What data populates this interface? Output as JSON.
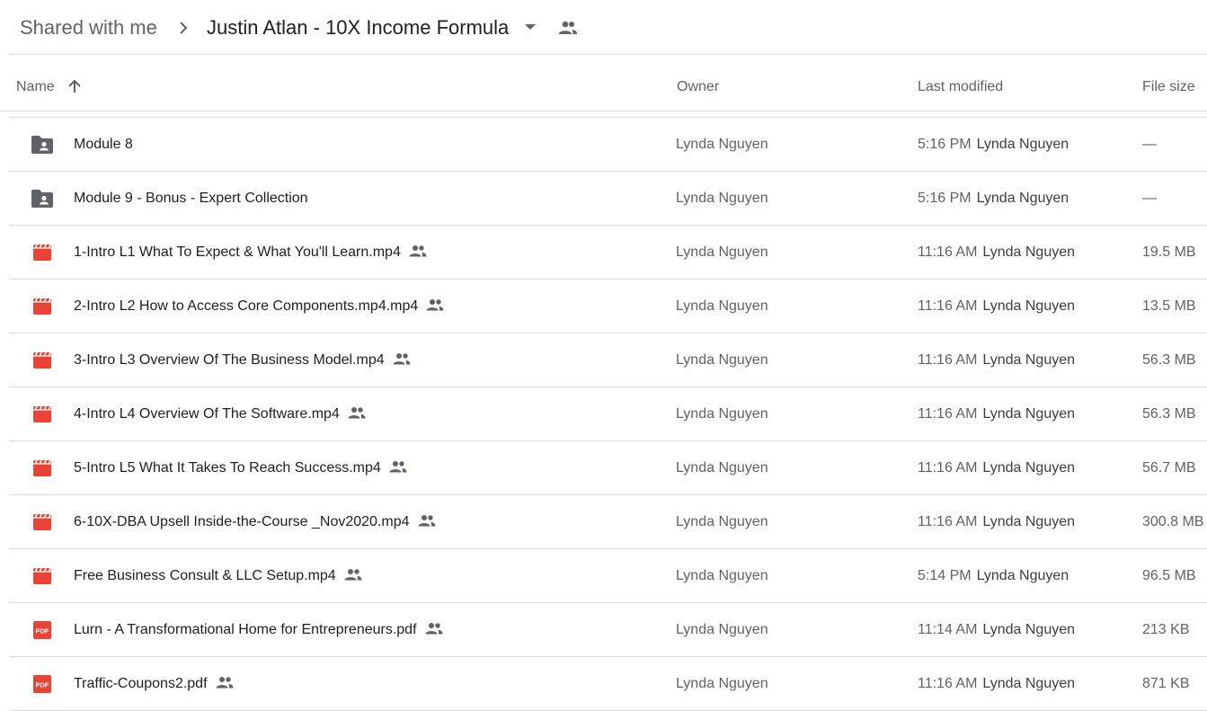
{
  "breadcrumb": {
    "root": "Shared with me",
    "current": "Justin Atlan - 10X Income Formula"
  },
  "columns": {
    "name": "Name",
    "owner": "Owner",
    "last_modified": "Last modified",
    "file_size": "File size"
  },
  "colors": {
    "folder": "#5f6368",
    "video": "#ea4335",
    "pdf": "#ea4335",
    "divider": "#dadce0"
  },
  "files": [
    {
      "name": "Module 8",
      "type": "shared-folder",
      "shared": false,
      "owner": "Lynda Nguyen",
      "time": "5:16 PM",
      "modified_by": "Lynda Nguyen",
      "size": "—"
    },
    {
      "name": "Module 9 - Bonus - Expert Collection",
      "type": "shared-folder",
      "shared": false,
      "owner": "Lynda Nguyen",
      "time": "5:16 PM",
      "modified_by": "Lynda Nguyen",
      "size": "—"
    },
    {
      "name": "1-Intro L1 What To Expect & What You'll Learn.mp4",
      "type": "video",
      "shared": true,
      "owner": "Lynda Nguyen",
      "time": "11:16 AM",
      "modified_by": "Lynda Nguyen",
      "size": "19.5 MB"
    },
    {
      "name": "2-Intro L2 How to Access Core Components.mp4.mp4",
      "type": "video",
      "shared": true,
      "owner": "Lynda Nguyen",
      "time": "11:16 AM",
      "modified_by": "Lynda Nguyen",
      "size": "13.5 MB"
    },
    {
      "name": "3-Intro L3 Overview Of The Business Model.mp4",
      "type": "video",
      "shared": true,
      "owner": "Lynda Nguyen",
      "time": "11:16 AM",
      "modified_by": "Lynda Nguyen",
      "size": "56.3 MB"
    },
    {
      "name": "4-Intro L4 Overview Of The Software.mp4",
      "type": "video",
      "shared": true,
      "owner": "Lynda Nguyen",
      "time": "11:16 AM",
      "modified_by": "Lynda Nguyen",
      "size": "56.3 MB"
    },
    {
      "name": "5-Intro L5 What It Takes To Reach Success.mp4",
      "type": "video",
      "shared": true,
      "owner": "Lynda Nguyen",
      "time": "11:16 AM",
      "modified_by": "Lynda Nguyen",
      "size": "56.7 MB"
    },
    {
      "name": "6-10X-DBA Upsell Inside-the-Course _Nov2020.mp4",
      "type": "video",
      "shared": true,
      "owner": "Lynda Nguyen",
      "time": "11:16 AM",
      "modified_by": "Lynda Nguyen",
      "size": "300.8 MB"
    },
    {
      "name": "Free Business Consult & LLC Setup.mp4",
      "type": "video",
      "shared": true,
      "owner": "Lynda Nguyen",
      "time": "5:14 PM",
      "modified_by": "Lynda Nguyen",
      "size": "96.5 MB"
    },
    {
      "name": "Lurn - A Transformational Home for Entrepreneurs.pdf",
      "type": "pdf",
      "shared": true,
      "owner": "Lynda Nguyen",
      "time": "11:14 AM",
      "modified_by": "Lynda Nguyen",
      "size": "213 KB"
    },
    {
      "name": "Traffic-Coupons2.pdf",
      "type": "pdf",
      "shared": true,
      "owner": "Lynda Nguyen",
      "time": "11:16 AM",
      "modified_by": "Lynda Nguyen",
      "size": "871 KB"
    }
  ],
  "icons": {
    "folder": "shared-folder-icon",
    "video": "video-file-icon",
    "pdf": "pdf-file-icon",
    "shared": "people-icon",
    "sort": "arrow-up-icon",
    "separator": "chevron-right-icon",
    "dropdown": "caret-down-icon"
  },
  "pdf_badge": "PDF"
}
